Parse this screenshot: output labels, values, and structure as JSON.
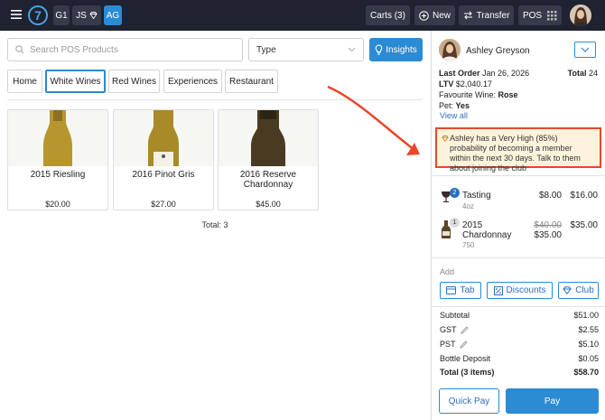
{
  "topbar": {
    "logo_text": "7",
    "g1": "G1",
    "js": "JS",
    "ag": "AG",
    "carts": "Carts (3)",
    "new": "New",
    "transfer": "Transfer",
    "pos": "POS"
  },
  "search": {
    "placeholder": "Search POS Products"
  },
  "type_select": {
    "value": "Type"
  },
  "insights_label": "Insights",
  "categories": [
    "Home",
    "White Wines",
    "Red Wines",
    "Experiences",
    "Restaurant"
  ],
  "active_category": "White Wines",
  "products": [
    {
      "name": "2015 Riesling",
      "price": "$20.00"
    },
    {
      "name": "2016 Pinot Gris",
      "price": "$27.00"
    },
    {
      "name": "2016 Reserve Chardonnay",
      "price": "$45.00"
    }
  ],
  "products_total": "Total: 3",
  "customer": {
    "name": "Ashley Greyson",
    "last_order_label": "Last Order",
    "last_order_date": "Jan 26, 2026",
    "total_label": "Total",
    "total_value": "24",
    "ltv_label": "LTV",
    "ltv_value": "$2,040.17",
    "fav_label": "Favourite Wine:",
    "fav_value": "Rose",
    "pet_label": "Pet:",
    "pet_value": "Yes",
    "view_all": "View all"
  },
  "alert_text": "Ashley has a Very High (85%) probability of becoming a member within the next 30 days. Talk to them about joining the club",
  "cart_items": [
    {
      "qty": "2",
      "name": "Tasting",
      "sub": "4oz",
      "unit": "$8.00",
      "total": "$16.00"
    },
    {
      "qty": "1",
      "name": "2015 Chardonnay",
      "sub": "750",
      "unit_original": "$40.00",
      "unit": "$35.00",
      "total": "$35.00"
    }
  ],
  "add_label": "Add",
  "add_buttons": {
    "tab": "Tab",
    "discounts": "Discounts",
    "club": "Club"
  },
  "totals": {
    "subtotal_label": "Subtotal",
    "subtotal": "$51.00",
    "gst_label": "GST",
    "gst": "$2.55",
    "pst_label": "PST",
    "pst": "$5.10",
    "deposit_label": "Bottle Deposit",
    "deposit": "$0.05",
    "total_label": "Total (3 items)",
    "total": "$58.70"
  },
  "quick_pay": "Quick Pay",
  "pay": "Pay",
  "colors": {
    "accent": "#2b8bd3",
    "topbar": "#1f2230",
    "alert_border": "#e8472a",
    "alert_bg": "#fdf3dd"
  }
}
